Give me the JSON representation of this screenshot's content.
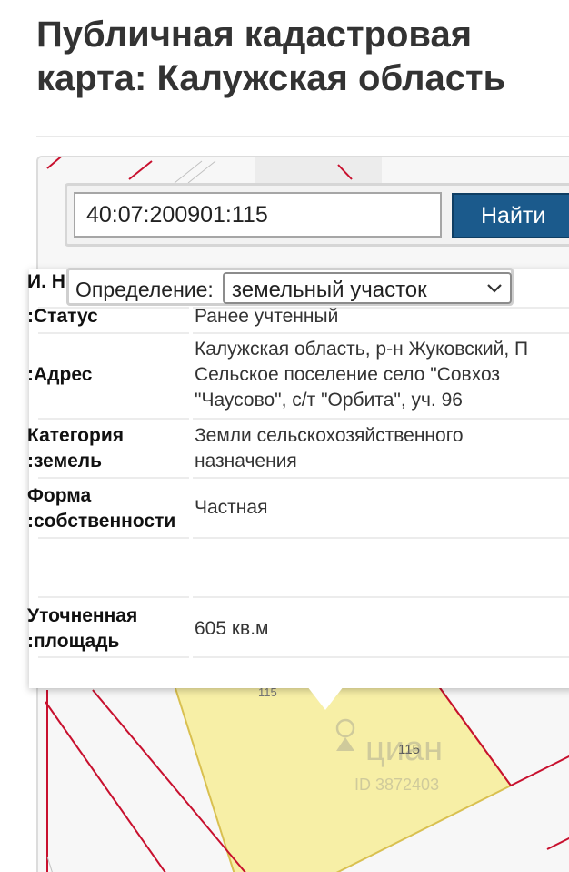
{
  "page": {
    "title_line1": "Публичная кадастровая",
    "title_line2": "карта: Калужская область"
  },
  "search": {
    "value": "40:07:200901:115",
    "button_label": "Найти"
  },
  "definition": {
    "label": "Определение:",
    "selected": "земельный участок"
  },
  "info": {
    "header_fragment": "И. Н",
    "rows": [
      {
        "label": "Статус:",
        "value_lines": [
          "Ранее учтенный"
        ]
      },
      {
        "label": "Адрес:",
        "value_lines": [
          "Калужская область, р-н Жуковский, П",
          "Сельское поселение село \"Совхоз",
          "\"Чаусово\", с/т \"Орбита\", уч. 96"
        ]
      },
      {
        "label_lines": [
          "Категория",
          "земель:"
        ],
        "value_lines": [
          "Земли сельскохозяйственного",
          "назначения"
        ]
      },
      {
        "label_lines": [
          "Форма",
          "собственности:"
        ],
        "value_lines": [
          "Частная"
        ]
      },
      {
        "label_lines": [
          "Уточненная",
          "площадь:"
        ],
        "value_lines": [
          "605 кв.м"
        ]
      }
    ]
  },
  "map": {
    "parcel_labels": [
      "115",
      "115"
    ],
    "watermark_text": "циан",
    "watermark_sub": "ID 3872403"
  },
  "colors": {
    "title": "#333333",
    "button": "#1b5a8c",
    "parcel_fill": "#f7efa6",
    "boundary": "#c8102e"
  },
  "icons": {
    "dropdown": "chevron-down-icon",
    "watermark": "cian-logo-icon"
  }
}
